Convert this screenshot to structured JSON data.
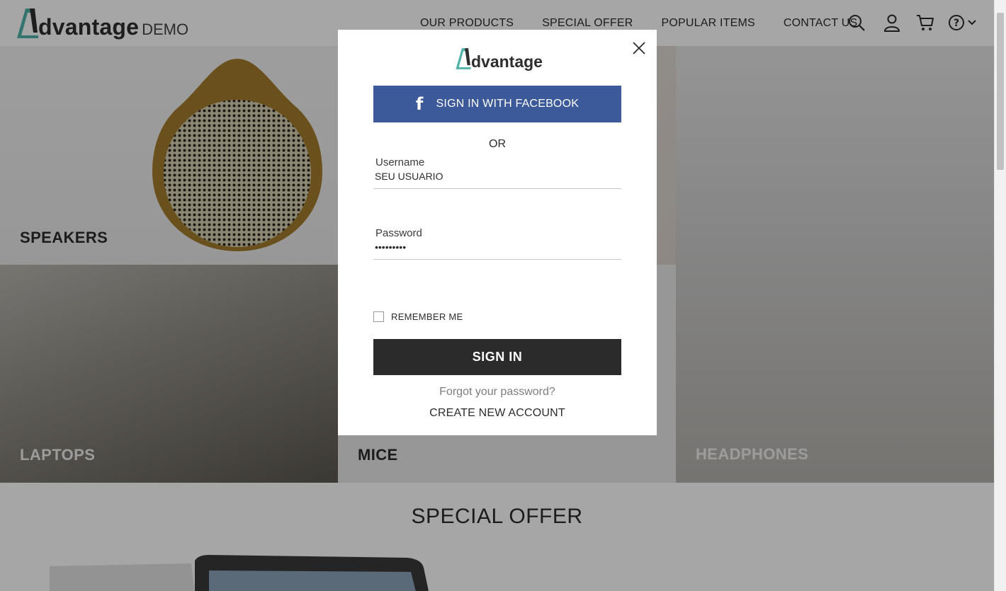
{
  "header": {
    "logo_word": "dvantage",
    "logo_suffix": "DEMO",
    "nav": [
      "OUR PRODUCTS",
      "SPECIAL OFFER",
      "POPULAR ITEMS",
      "CONTACT US"
    ],
    "icons": [
      "search-icon",
      "user-icon",
      "cart-icon",
      "help-icon"
    ]
  },
  "tiles": {
    "speakers": "SPEAKERS",
    "laptops": "LAPTOPS",
    "mice": "MICE",
    "headphones": "HEADPHONES"
  },
  "special_offer_title": "SPECIAL OFFER",
  "modal": {
    "logo_word": "dvantage",
    "facebook_label": "SIGN IN WITH FACEBOOK",
    "or_label": "OR",
    "username_label": "Username",
    "username_value": "SEU USUARIO",
    "password_label": "Password",
    "password_value": "123456789",
    "remember_label": "REMEMBER ME",
    "signin_label": "SIGN IN",
    "forgot_label": "Forgot your password?",
    "create_label": "CREATE NEW ACCOUNT"
  },
  "colors": {
    "brand_teal": "#4fb3a9",
    "facebook_blue": "#3c5a99",
    "dark_button": "#2b2b2b"
  }
}
